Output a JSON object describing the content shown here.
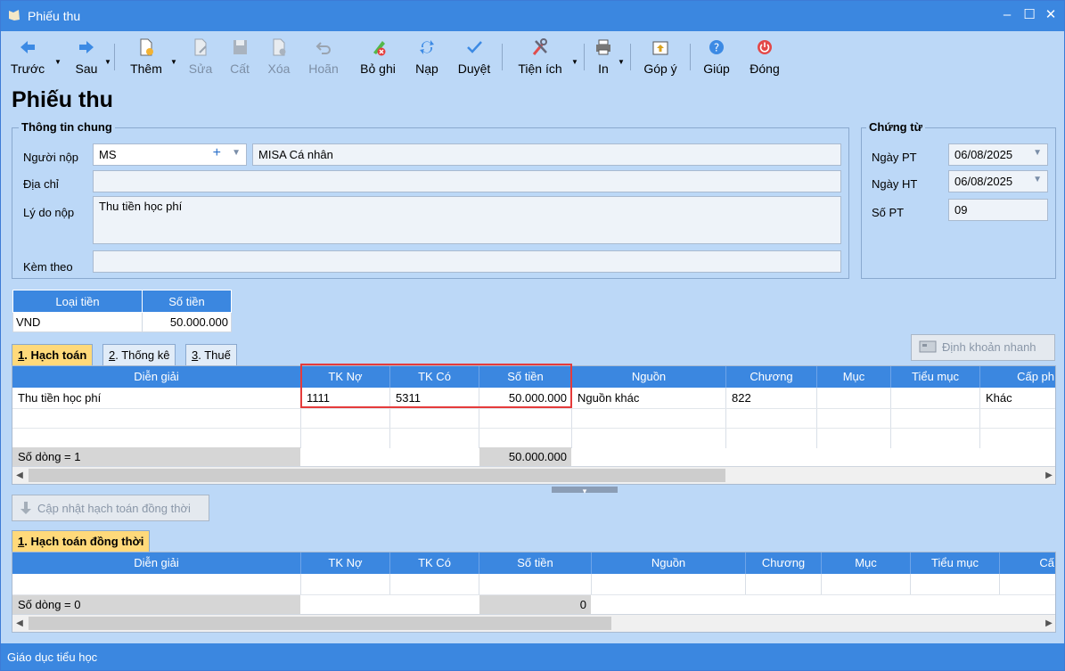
{
  "window": {
    "title": "Phiếu thu",
    "minimize": "–",
    "maximize": "☐",
    "close": "✕"
  },
  "toolbar": {
    "back": "Trước",
    "next": "Sau",
    "add": "Thêm",
    "edit": "Sửa",
    "save": "Cất",
    "delete": "Xóa",
    "undo": "Hoãn",
    "unpost": "Bỏ ghi",
    "reload": "Nạp",
    "approve": "Duyệt",
    "utilities": "Tiện ích",
    "print": "In",
    "feedback": "Góp ý",
    "help": "Giúp",
    "close": "Đóng"
  },
  "page": {
    "title": "Phiếu thu"
  },
  "general": {
    "legend": "Thông tin chung",
    "payer_label": "Người nộp",
    "payer_code": "MS",
    "payer_name": "MISA Cá nhân",
    "address_label": "Địa chỉ",
    "address": "",
    "reason_label": "Lý do nộp",
    "reason": "Thu tiền học phí",
    "attach_label": "Kèm theo",
    "attach": ""
  },
  "voucher": {
    "legend": "Chứng từ",
    "date_pt_label": "Ngày PT",
    "date_pt": "06/08/2025",
    "date_ht_label": "Ngày HT",
    "date_ht": "06/08/2025",
    "number_label": "Số PT",
    "number": "09"
  },
  "currency": {
    "type_header": "Loại tiền",
    "amount_header": "Số tiền",
    "type": "VND",
    "amount": "50.000.000"
  },
  "tabs": {
    "t1_num": "1",
    "t1_rest": ". Hạch toán",
    "t2_num": "2",
    "t2_rest": ". Thống kê",
    "t3_num": "3",
    "t3_rest": ". Thuế"
  },
  "quick_entry": "Định khoản nhanh",
  "grid1": {
    "headers": [
      "Diễn giải",
      "TK Nợ",
      "TK Có",
      "Số tiền",
      "Nguồn",
      "Chương",
      "Mục",
      "Tiểu mục",
      "Cấp ph"
    ],
    "row": {
      "desc": "Thu tiền học phí",
      "debit": "1111",
      "credit": "5311",
      "amount": "50.000.000",
      "source": "Nguồn khác",
      "chapter": "822",
      "level": "Khác"
    },
    "summary_label": "Số dòng = 1",
    "summary_amount": "50.000.000"
  },
  "update_button": "Cập nhật hạch toán đồng thời",
  "tab_simul": {
    "num": "1",
    "rest": ". Hạch toán đồng thời"
  },
  "grid2": {
    "headers": [
      "Diễn giải",
      "TK Nợ",
      "TK Có",
      "Số tiền",
      "Nguồn",
      "Chương",
      "Mục",
      "Tiểu mục",
      "Cấ"
    ],
    "summary_label": "Số dòng = 0",
    "summary_amount": "0"
  },
  "status": {
    "text": "Giáo dục tiểu học"
  }
}
